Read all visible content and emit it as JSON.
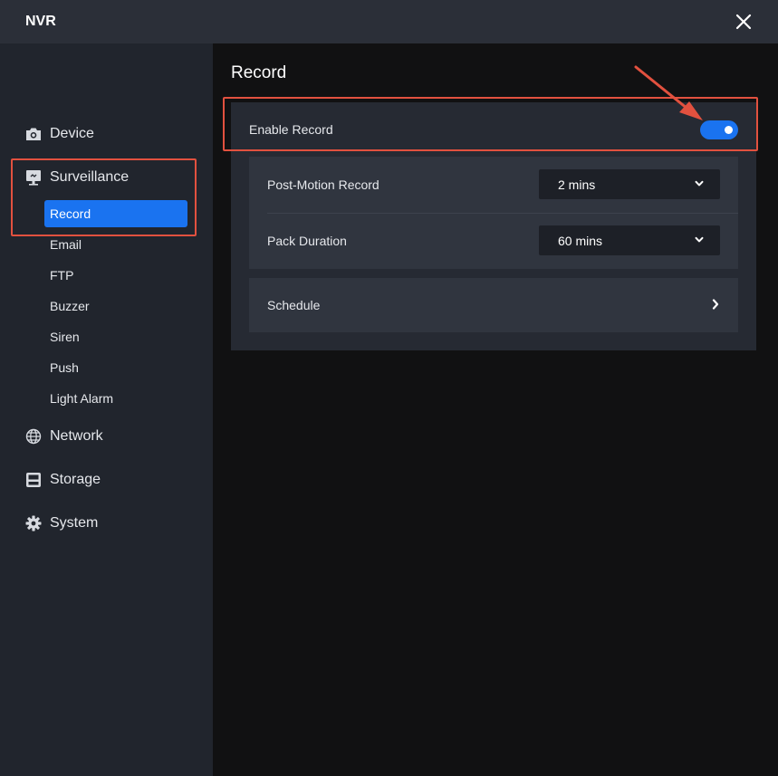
{
  "window": {
    "title": "NVR"
  },
  "sidebar": {
    "groups": [
      {
        "label": "Device",
        "icon": "camera-icon"
      },
      {
        "label": "Surveillance",
        "icon": "monitor-icon"
      },
      {
        "label": "Network",
        "icon": "globe-icon"
      },
      {
        "label": "Storage",
        "icon": "disk-icon"
      },
      {
        "label": "System",
        "icon": "gear-icon"
      }
    ],
    "surveillance_items": [
      {
        "label": "Record",
        "active": true
      },
      {
        "label": "Email",
        "active": false
      },
      {
        "label": "FTP",
        "active": false
      },
      {
        "label": "Buzzer",
        "active": false
      },
      {
        "label": "Siren",
        "active": false
      },
      {
        "label": "Push",
        "active": false
      },
      {
        "label": "Light Alarm",
        "active": false
      }
    ]
  },
  "main": {
    "title": "Record",
    "enable_record": {
      "label": "Enable Record",
      "enabled": true
    },
    "post_motion": {
      "label": "Post-Motion Record",
      "value": "2 mins"
    },
    "pack_duration": {
      "label": "Pack Duration",
      "value": "60 mins"
    },
    "schedule": {
      "label": "Schedule"
    }
  },
  "colors": {
    "accent": "#1a73f0",
    "highlight": "#e2513f",
    "sidebar_bg": "#21252d",
    "titlebar_bg": "#2b2f38"
  }
}
